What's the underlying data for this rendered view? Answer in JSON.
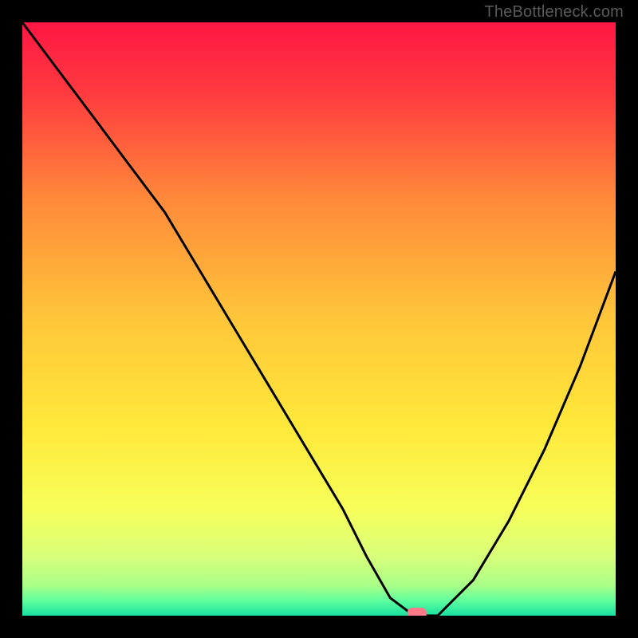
{
  "watermark": "TheBottleneck.com",
  "chart_data": {
    "type": "line",
    "title": "",
    "xlabel": "",
    "ylabel": "",
    "xlim": [
      0,
      100
    ],
    "ylim": [
      0,
      100
    ],
    "grid": false,
    "legend": false,
    "background": {
      "type": "vertical-gradient",
      "description": "Red at top through orange and yellow to green at bottom, indicating bottleneck severity (red=high, green=low)",
      "stops": [
        {
          "pos": 0.0,
          "color": "#ff1744"
        },
        {
          "pos": 0.12,
          "color": "#ff3b3f"
        },
        {
          "pos": 0.3,
          "color": "#ff8a3a"
        },
        {
          "pos": 0.5,
          "color": "#ffc63a"
        },
        {
          "pos": 0.68,
          "color": "#ffe83a"
        },
        {
          "pos": 0.82,
          "color": "#f7ff5a"
        },
        {
          "pos": 0.9,
          "color": "#d8ff7a"
        },
        {
          "pos": 0.95,
          "color": "#a8ff88"
        },
        {
          "pos": 0.975,
          "color": "#5eff9e"
        },
        {
          "pos": 1.0,
          "color": "#18e0a0"
        }
      ]
    },
    "series": [
      {
        "name": "bottleneck-curve",
        "color": "#000000",
        "x": [
          0,
          6,
          12,
          18,
          24,
          30,
          36,
          42,
          48,
          54,
          58,
          62,
          66,
          70,
          76,
          82,
          88,
          94,
          100
        ],
        "y": [
          100,
          92,
          84,
          76,
          68,
          58,
          48,
          38,
          28,
          18,
          10,
          3,
          0,
          0,
          6,
          16,
          28,
          42,
          58
        ]
      }
    ],
    "marker": {
      "name": "current-config",
      "shape": "rounded-rect",
      "x": 66.5,
      "y": 0,
      "color": "#ff7a88"
    }
  }
}
